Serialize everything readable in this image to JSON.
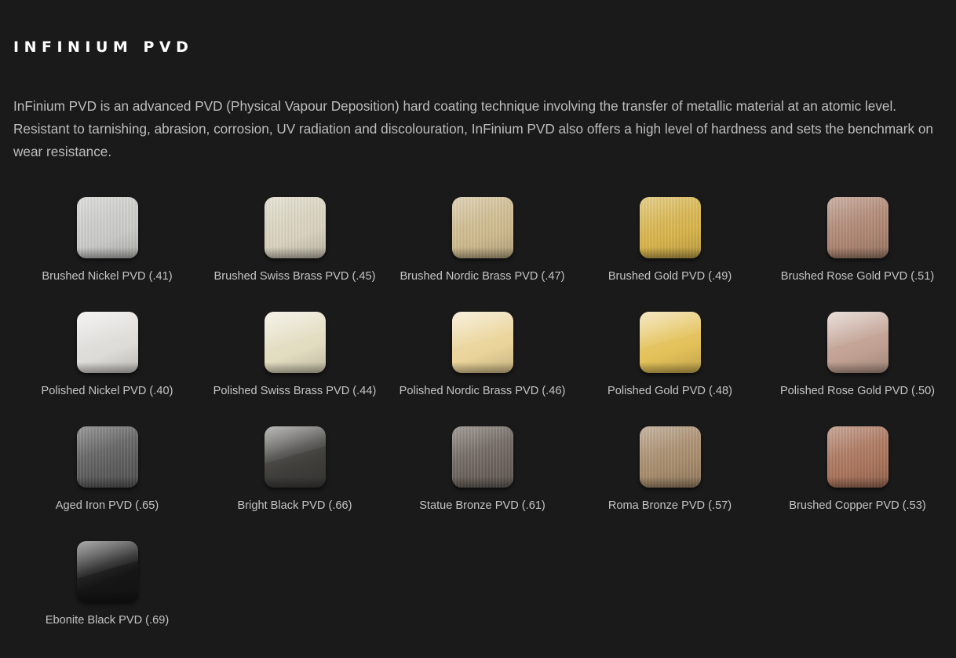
{
  "section": {
    "title": "INFINIUM PVD",
    "description": "InFinium PVD is an advanced PVD (Physical Vapour Deposition) hard coating technique involving the transfer of metallic material at an atomic level. Resistant to tarnishing, abrasion, corrosion, UV radiation and discolouration, InFinium PVD also offers a high level of hardness and sets the benchmark on wear resistance."
  },
  "finishes": [
    {
      "label": "Brushed Nickel PVD (.41)",
      "color": "#c9c9c7",
      "finish": "brushed"
    },
    {
      "label": "Brushed Swiss Brass PVD (.45)",
      "color": "#d8d2bd",
      "finish": "brushed"
    },
    {
      "label": "Brushed Nordic Brass PVD (.47)",
      "color": "#cdb98c",
      "finish": "brushed"
    },
    {
      "label": "Brushed Gold PVD (.49)",
      "color": "#d6b248",
      "finish": "brushed"
    },
    {
      "label": "Brushed Rose Gold PVD (.51)",
      "color": "#ad8470",
      "finish": "brushed"
    },
    {
      "label": "Polished Nickel PVD (.40)",
      "color": "#dedcd8",
      "finish": "polished"
    },
    {
      "label": "Polished Swiss Brass PVD (.44)",
      "color": "#e2dcc0",
      "finish": "polished"
    },
    {
      "label": "Polished Nordic Brass PVD (.46)",
      "color": "#ead49a",
      "finish": "polished"
    },
    {
      "label": "Polished Gold PVD (.48)",
      "color": "#e3c159",
      "finish": "polished"
    },
    {
      "label": "Polished Rose Gold PVD (.50)",
      "color": "#c1a193",
      "finish": "polished"
    },
    {
      "label": "Aged Iron PVD (.65)",
      "color": "#5b5b5b",
      "finish": "brushed"
    },
    {
      "label": "Bright Black PVD (.66)",
      "color": "#3f3e3b",
      "finish": "polished"
    },
    {
      "label": "Statue Bronze PVD (.61)",
      "color": "#6b625b",
      "finish": "brushed"
    },
    {
      "label": "Roma Bronze PVD (.57)",
      "color": "#a68a6a",
      "finish": "brushed"
    },
    {
      "label": "Brushed Copper PVD (.53)",
      "color": "#a97259",
      "finish": "brushed"
    },
    {
      "label": "Ebonite Black PVD (.69)",
      "color": "#151515",
      "finish": "polished"
    }
  ]
}
